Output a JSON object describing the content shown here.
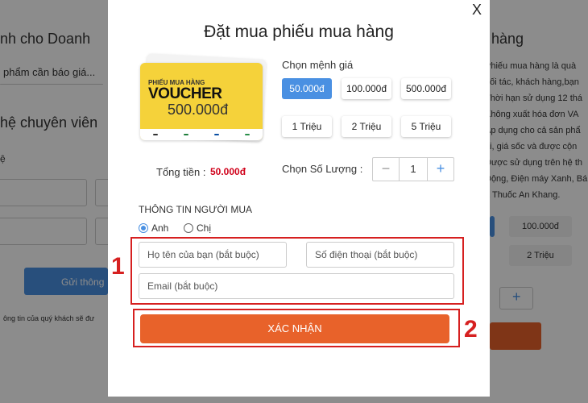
{
  "background": {
    "left_texts": [
      "nh cho Doanh",
      "phẩm cần báo giá...",
      "hệ chuyên viên",
      "ệ",
      "Gửi thông",
      "ông tin của quý khách sẽ đư"
    ],
    "right_texts": [
      "hàng",
      "Phiếu mua hàng là quà",
      "đối tác, khách hàng,bạn",
      "Thời hạn sử dụng 12 thá",
      "Không xuất hóa đơn VA",
      "Áp dụng cho cả sản phẩ",
      "ãi, giá sốc và được cộn",
      "Được sử dụng trên hệ th",
      "Động, Điện máy Xanh, Bá",
      "à Thuốc An Khang."
    ],
    "right_buttons": [
      "100.000đ",
      "2 Triệu"
    ],
    "right_plus": "+"
  },
  "modal": {
    "close": "X",
    "title": "Đặt mua phiếu mua hàng",
    "voucher": {
      "small": "PHIẾU MUA HÀNG",
      "big": "VOUCHER",
      "amount": "500.000đ"
    },
    "denomination_label": "Chọn mệnh giá",
    "denominations": [
      "50.000đ",
      "100.000đ",
      "500.000đ",
      "1 Triệu",
      "2 Triệu",
      "5 Triệu"
    ],
    "total_label": "Tổng tiền :",
    "total_value": "50.000đ",
    "quantity_label": "Chọn Số Lượng :",
    "quantity_value": "1",
    "minus": "−",
    "plus": "+",
    "buyer_heading": "THÔNG TIN NGƯỜI MUA",
    "gender_options": [
      "Anh",
      "Chị"
    ],
    "name_placeholder": "Họ tên của bạn (bắt buộc)",
    "phone_placeholder": "Số điện thoại (bắt buộc)",
    "email_placeholder": "Email (bắt buộc)",
    "submit": "XÁC NHẬN"
  },
  "callouts": [
    "1",
    "2"
  ],
  "colors": {
    "accent": "#4a90e2",
    "submit": "#e8622a",
    "callout": "#d62020",
    "total": "#d0021b"
  }
}
